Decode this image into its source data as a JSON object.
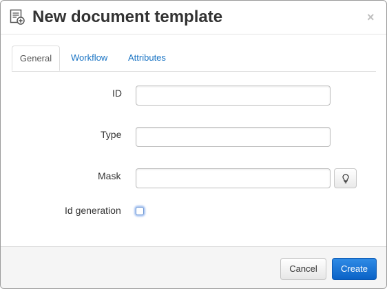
{
  "dialog": {
    "title": "New document template",
    "close_symbol": "×",
    "header_icon": "document-add-icon"
  },
  "tabs": [
    {
      "label": "General",
      "active": true
    },
    {
      "label": "Workflow",
      "active": false
    },
    {
      "label": "Attributes",
      "active": false
    }
  ],
  "form": {
    "id": {
      "label": "ID",
      "value": ""
    },
    "type": {
      "label": "Type",
      "value": ""
    },
    "mask": {
      "label": "Mask",
      "value": "",
      "hint_icon": "lightbulb-icon"
    },
    "id_generation": {
      "label": "Id generation",
      "checked": false
    }
  },
  "footer": {
    "cancel_label": "Cancel",
    "create_label": "Create"
  },
  "colors": {
    "primary": "#0a62c6",
    "link": "#1a74c4",
    "focus_ring": "#6f98d4"
  }
}
